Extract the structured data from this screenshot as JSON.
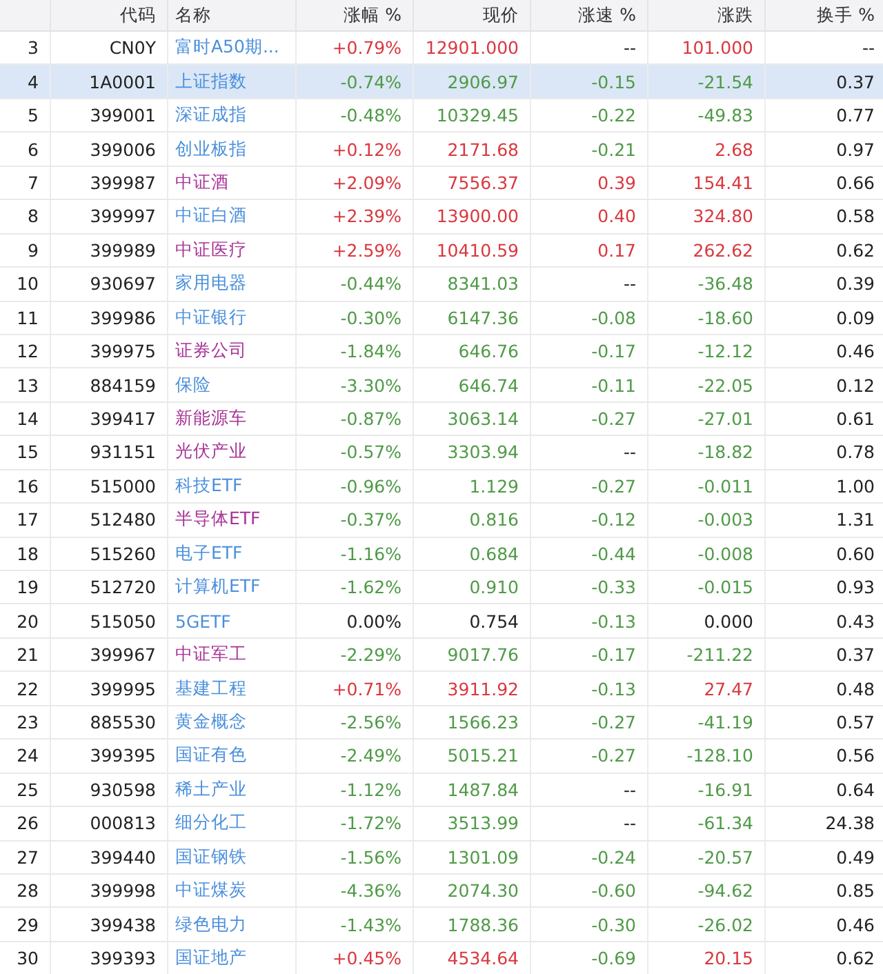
{
  "table": {
    "columns": [
      "代码",
      "名称",
      "涨幅 %",
      "现价",
      "涨速 %",
      "涨跌",
      "换手 %"
    ],
    "rows": [
      {
        "no": "3",
        "selected": false,
        "cells": [
          {
            "text": "CN0Y"
          },
          {
            "text": "富时A50期...",
            "color": "#4a8fdc"
          },
          {
            "text": "+0.79%",
            "color": "#d9383e"
          },
          {
            "text": "12901.000",
            "color": "#d9383e"
          },
          {
            "text": "--",
            "color": "#222222"
          },
          {
            "text": "101.000",
            "color": "#d9383e"
          },
          {
            "text": "--"
          }
        ]
      },
      {
        "no": "4",
        "selected": true,
        "cells": [
          {
            "text": "1A0001"
          },
          {
            "text": "上证指数",
            "color": "#4a8fdc"
          },
          {
            "text": "-0.74%",
            "color": "#4f9a47"
          },
          {
            "text": "2906.97",
            "color": "#4f9a47"
          },
          {
            "text": "-0.15",
            "color": "#4f9a47"
          },
          {
            "text": "-21.54",
            "color": "#4f9a47"
          },
          {
            "text": "0.37"
          }
        ]
      },
      {
        "no": "5",
        "selected": false,
        "cells": [
          {
            "text": "399001"
          },
          {
            "text": "深证成指",
            "color": "#4a8fdc"
          },
          {
            "text": "-0.48%",
            "color": "#4f9a47"
          },
          {
            "text": "10329.45",
            "color": "#4f9a47"
          },
          {
            "text": "-0.22",
            "color": "#4f9a47"
          },
          {
            "text": "-49.83",
            "color": "#4f9a47"
          },
          {
            "text": "0.77"
          }
        ]
      },
      {
        "no": "6",
        "selected": false,
        "cells": [
          {
            "text": "399006"
          },
          {
            "text": "创业板指",
            "color": "#4a8fdc"
          },
          {
            "text": "+0.12%",
            "color": "#d9383e"
          },
          {
            "text": "2171.68",
            "color": "#d9383e"
          },
          {
            "text": "-0.21",
            "color": "#4f9a47"
          },
          {
            "text": "2.68",
            "color": "#d9383e"
          },
          {
            "text": "0.97"
          }
        ]
      },
      {
        "no": "7",
        "selected": false,
        "cells": [
          {
            "text": "399987"
          },
          {
            "text": "中证酒",
            "color": "#a83296"
          },
          {
            "text": "+2.09%",
            "color": "#d9383e"
          },
          {
            "text": "7556.37",
            "color": "#d9383e"
          },
          {
            "text": "0.39",
            "color": "#d9383e"
          },
          {
            "text": "154.41",
            "color": "#d9383e"
          },
          {
            "text": "0.66"
          }
        ]
      },
      {
        "no": "8",
        "selected": false,
        "cells": [
          {
            "text": "399997"
          },
          {
            "text": "中证白酒",
            "color": "#4a8fdc"
          },
          {
            "text": "+2.39%",
            "color": "#d9383e"
          },
          {
            "text": "13900.00",
            "color": "#d9383e"
          },
          {
            "text": "0.40",
            "color": "#d9383e"
          },
          {
            "text": "324.80",
            "color": "#d9383e"
          },
          {
            "text": "0.58"
          }
        ]
      },
      {
        "no": "9",
        "selected": false,
        "cells": [
          {
            "text": "399989"
          },
          {
            "text": "中证医疗",
            "color": "#a83296"
          },
          {
            "text": "+2.59%",
            "color": "#d9383e"
          },
          {
            "text": "10410.59",
            "color": "#d9383e"
          },
          {
            "text": "0.17",
            "color": "#d9383e"
          },
          {
            "text": "262.62",
            "color": "#d9383e"
          },
          {
            "text": "0.62"
          }
        ]
      },
      {
        "no": "10",
        "selected": false,
        "cells": [
          {
            "text": "930697"
          },
          {
            "text": "家用电器",
            "color": "#4a8fdc"
          },
          {
            "text": "-0.44%",
            "color": "#4f9a47"
          },
          {
            "text": "8341.03",
            "color": "#4f9a47"
          },
          {
            "text": "--",
            "color": "#222222"
          },
          {
            "text": "-36.48",
            "color": "#4f9a47"
          },
          {
            "text": "0.39"
          }
        ]
      },
      {
        "no": "11",
        "selected": false,
        "cells": [
          {
            "text": "399986"
          },
          {
            "text": "中证银行",
            "color": "#4a8fdc"
          },
          {
            "text": "-0.30%",
            "color": "#4f9a47"
          },
          {
            "text": "6147.36",
            "color": "#4f9a47"
          },
          {
            "text": "-0.08",
            "color": "#4f9a47"
          },
          {
            "text": "-18.60",
            "color": "#4f9a47"
          },
          {
            "text": "0.09"
          }
        ]
      },
      {
        "no": "12",
        "selected": false,
        "cells": [
          {
            "text": "399975"
          },
          {
            "text": "证券公司",
            "color": "#a83296"
          },
          {
            "text": "-1.84%",
            "color": "#4f9a47"
          },
          {
            "text": "646.76",
            "color": "#4f9a47"
          },
          {
            "text": "-0.17",
            "color": "#4f9a47"
          },
          {
            "text": "-12.12",
            "color": "#4f9a47"
          },
          {
            "text": "0.46"
          }
        ]
      },
      {
        "no": "13",
        "selected": false,
        "cells": [
          {
            "text": "884159"
          },
          {
            "text": "保险",
            "color": "#4a8fdc"
          },
          {
            "text": "-3.30%",
            "color": "#4f9a47"
          },
          {
            "text": "646.74",
            "color": "#4f9a47"
          },
          {
            "text": "-0.11",
            "color": "#4f9a47"
          },
          {
            "text": "-22.05",
            "color": "#4f9a47"
          },
          {
            "text": "0.12"
          }
        ]
      },
      {
        "no": "14",
        "selected": false,
        "cells": [
          {
            "text": "399417"
          },
          {
            "text": "新能源车",
            "color": "#a83296"
          },
          {
            "text": "-0.87%",
            "color": "#4f9a47"
          },
          {
            "text": "3063.14",
            "color": "#4f9a47"
          },
          {
            "text": "-0.27",
            "color": "#4f9a47"
          },
          {
            "text": "-27.01",
            "color": "#4f9a47"
          },
          {
            "text": "0.61"
          }
        ]
      },
      {
        "no": "15",
        "selected": false,
        "cells": [
          {
            "text": "931151"
          },
          {
            "text": "光伏产业",
            "color": "#a83296"
          },
          {
            "text": "-0.57%",
            "color": "#4f9a47"
          },
          {
            "text": "3303.94",
            "color": "#4f9a47"
          },
          {
            "text": "--",
            "color": "#222222"
          },
          {
            "text": "-18.82",
            "color": "#4f9a47"
          },
          {
            "text": "0.78"
          }
        ]
      },
      {
        "no": "16",
        "selected": false,
        "cells": [
          {
            "text": "515000"
          },
          {
            "text": "科技ETF",
            "color": "#4a8fdc"
          },
          {
            "text": "-0.96%",
            "color": "#4f9a47"
          },
          {
            "text": "1.129",
            "color": "#4f9a47"
          },
          {
            "text": "-0.27",
            "color": "#4f9a47"
          },
          {
            "text": "-0.011",
            "color": "#4f9a47"
          },
          {
            "text": "1.00"
          }
        ]
      },
      {
        "no": "17",
        "selected": false,
        "cells": [
          {
            "text": "512480"
          },
          {
            "text": "半导体ETF",
            "color": "#a83296"
          },
          {
            "text": "-0.37%",
            "color": "#4f9a47"
          },
          {
            "text": "0.816",
            "color": "#4f9a47"
          },
          {
            "text": "-0.12",
            "color": "#4f9a47"
          },
          {
            "text": "-0.003",
            "color": "#4f9a47"
          },
          {
            "text": "1.31"
          }
        ]
      },
      {
        "no": "18",
        "selected": false,
        "cells": [
          {
            "text": "515260"
          },
          {
            "text": "电子ETF",
            "color": "#4a8fdc"
          },
          {
            "text": "-1.16%",
            "color": "#4f9a47"
          },
          {
            "text": "0.684",
            "color": "#4f9a47"
          },
          {
            "text": "-0.44",
            "color": "#4f9a47"
          },
          {
            "text": "-0.008",
            "color": "#4f9a47"
          },
          {
            "text": "0.60"
          }
        ]
      },
      {
        "no": "19",
        "selected": false,
        "cells": [
          {
            "text": "512720"
          },
          {
            "text": "计算机ETF",
            "color": "#4a8fdc"
          },
          {
            "text": "-1.62%",
            "color": "#4f9a47"
          },
          {
            "text": "0.910",
            "color": "#4f9a47"
          },
          {
            "text": "-0.33",
            "color": "#4f9a47"
          },
          {
            "text": "-0.015",
            "color": "#4f9a47"
          },
          {
            "text": "0.93"
          }
        ]
      },
      {
        "no": "20",
        "selected": false,
        "cells": [
          {
            "text": "515050"
          },
          {
            "text": "5GETF",
            "color": "#4a8fdc"
          },
          {
            "text": "0.00%",
            "color": "#222222"
          },
          {
            "text": "0.754",
            "color": "#222222"
          },
          {
            "text": "-0.13",
            "color": "#4f9a47"
          },
          {
            "text": "0.000",
            "color": "#222222"
          },
          {
            "text": "0.43"
          }
        ]
      },
      {
        "no": "21",
        "selected": false,
        "cells": [
          {
            "text": "399967"
          },
          {
            "text": "中证军工",
            "color": "#a83296"
          },
          {
            "text": "-2.29%",
            "color": "#4f9a47"
          },
          {
            "text": "9017.76",
            "color": "#4f9a47"
          },
          {
            "text": "-0.17",
            "color": "#4f9a47"
          },
          {
            "text": "-211.22",
            "color": "#4f9a47"
          },
          {
            "text": "0.37"
          }
        ]
      },
      {
        "no": "22",
        "selected": false,
        "cells": [
          {
            "text": "399995"
          },
          {
            "text": "基建工程",
            "color": "#4a8fdc"
          },
          {
            "text": "+0.71%",
            "color": "#d9383e"
          },
          {
            "text": "3911.92",
            "color": "#d9383e"
          },
          {
            "text": "-0.13",
            "color": "#4f9a47"
          },
          {
            "text": "27.47",
            "color": "#d9383e"
          },
          {
            "text": "0.48"
          }
        ]
      },
      {
        "no": "23",
        "selected": false,
        "cells": [
          {
            "text": "885530"
          },
          {
            "text": "黄金概念",
            "color": "#4a8fdc"
          },
          {
            "text": "-2.56%",
            "color": "#4f9a47"
          },
          {
            "text": "1566.23",
            "color": "#4f9a47"
          },
          {
            "text": "-0.27",
            "color": "#4f9a47"
          },
          {
            "text": "-41.19",
            "color": "#4f9a47"
          },
          {
            "text": "0.57"
          }
        ]
      },
      {
        "no": "24",
        "selected": false,
        "cells": [
          {
            "text": "399395"
          },
          {
            "text": "国证有色",
            "color": "#4a8fdc"
          },
          {
            "text": "-2.49%",
            "color": "#4f9a47"
          },
          {
            "text": "5015.21",
            "color": "#4f9a47"
          },
          {
            "text": "-0.27",
            "color": "#4f9a47"
          },
          {
            "text": "-128.10",
            "color": "#4f9a47"
          },
          {
            "text": "0.56"
          }
        ]
      },
      {
        "no": "25",
        "selected": false,
        "cells": [
          {
            "text": "930598"
          },
          {
            "text": "稀土产业",
            "color": "#4a8fdc"
          },
          {
            "text": "-1.12%",
            "color": "#4f9a47"
          },
          {
            "text": "1487.84",
            "color": "#4f9a47"
          },
          {
            "text": "--",
            "color": "#222222"
          },
          {
            "text": "-16.91",
            "color": "#4f9a47"
          },
          {
            "text": "0.64"
          }
        ]
      },
      {
        "no": "26",
        "selected": false,
        "cells": [
          {
            "text": "000813"
          },
          {
            "text": "细分化工",
            "color": "#4a8fdc"
          },
          {
            "text": "-1.72%",
            "color": "#4f9a47"
          },
          {
            "text": "3513.99",
            "color": "#4f9a47"
          },
          {
            "text": "--",
            "color": "#222222"
          },
          {
            "text": "-61.34",
            "color": "#4f9a47"
          },
          {
            "text": "24.38"
          }
        ]
      },
      {
        "no": "27",
        "selected": false,
        "cells": [
          {
            "text": "399440"
          },
          {
            "text": "国证钢铁",
            "color": "#4a8fdc"
          },
          {
            "text": "-1.56%",
            "color": "#4f9a47"
          },
          {
            "text": "1301.09",
            "color": "#4f9a47"
          },
          {
            "text": "-0.24",
            "color": "#4f9a47"
          },
          {
            "text": "-20.57",
            "color": "#4f9a47"
          },
          {
            "text": "0.49"
          }
        ]
      },
      {
        "no": "28",
        "selected": false,
        "cells": [
          {
            "text": "399998"
          },
          {
            "text": "中证煤炭",
            "color": "#4a8fdc"
          },
          {
            "text": "-4.36%",
            "color": "#4f9a47"
          },
          {
            "text": "2074.30",
            "color": "#4f9a47"
          },
          {
            "text": "-0.60",
            "color": "#4f9a47"
          },
          {
            "text": "-94.62",
            "color": "#4f9a47"
          },
          {
            "text": "0.85"
          }
        ]
      },
      {
        "no": "29",
        "selected": false,
        "cells": [
          {
            "text": "399438"
          },
          {
            "text": "绿色电力",
            "color": "#4a8fdc"
          },
          {
            "text": "-1.43%",
            "color": "#4f9a47"
          },
          {
            "text": "1788.36",
            "color": "#4f9a47"
          },
          {
            "text": "-0.30",
            "color": "#4f9a47"
          },
          {
            "text": "-26.02",
            "color": "#4f9a47"
          },
          {
            "text": "0.46"
          }
        ]
      },
      {
        "no": "30",
        "selected": false,
        "cells": [
          {
            "text": "399393"
          },
          {
            "text": "国证地产",
            "color": "#4a8fdc"
          },
          {
            "text": "+0.45%",
            "color": "#d9383e"
          },
          {
            "text": "4534.64",
            "color": "#d9383e"
          },
          {
            "text": "-0.69",
            "color": "#4f9a47"
          },
          {
            "text": "20.15",
            "color": "#d9383e"
          },
          {
            "text": "0.62"
          }
        ]
      }
    ]
  }
}
